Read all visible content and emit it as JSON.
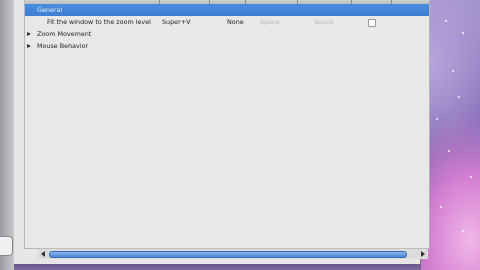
{
  "settings_tree": {
    "groups": [
      {
        "label": "General",
        "selected": true,
        "rows": [
          {
            "action": "Fit the window to the zoom level",
            "shortcut": "Super+V",
            "alternate": "None",
            "faded_a": "Space",
            "faded_b": "Space",
            "checked": false
          }
        ]
      },
      {
        "label": "Zoom Movement",
        "selected": false
      },
      {
        "label": "Mouse Behavior",
        "selected": false
      }
    ]
  },
  "colors": {
    "selection": "#3d7ed4",
    "window_bg": "#e8e8e8",
    "scroll_thumb": "#4a86d6"
  }
}
